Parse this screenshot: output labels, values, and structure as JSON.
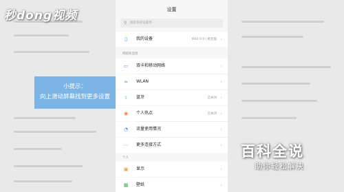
{
  "watermark_top": "秒dong视频",
  "tip": {
    "line1": "小提示：",
    "line2": "向上滑动屏幕找到更多设置"
  },
  "phone": {
    "title": "设置",
    "search_placeholder": "搜索系统设置项",
    "device": {
      "label": "我的设备",
      "value": "MIUI 9.0 | 稳定版"
    },
    "section_network": "网络和连接",
    "network_items": [
      {
        "label": "双卡和移动网络",
        "icon": "sim-icon",
        "value": ""
      },
      {
        "label": "WLAN",
        "icon": "wifi-icon",
        "value": ""
      },
      {
        "label": "蓝牙",
        "icon": "bluetooth-icon",
        "value": "已关闭"
      },
      {
        "label": "个人热点",
        "icon": "hotspot-icon",
        "value": "已关闭"
      },
      {
        "label": "流量使用情况",
        "icon": "data-usage-icon",
        "value": ""
      },
      {
        "label": "更多连接方式",
        "icon": "more-icon",
        "value": ""
      }
    ],
    "section_personal": "个人",
    "personal_items": [
      {
        "label": "显示",
        "icon": "display-icon"
      },
      {
        "label": "壁纸",
        "icon": "wallpaper-icon"
      }
    ]
  },
  "watermark_brand": "百科全说",
  "watermark_slogan": "助你轻松解决",
  "colors": {
    "tip_bg": "#7cb4e6",
    "accent": "#4a8de0"
  }
}
